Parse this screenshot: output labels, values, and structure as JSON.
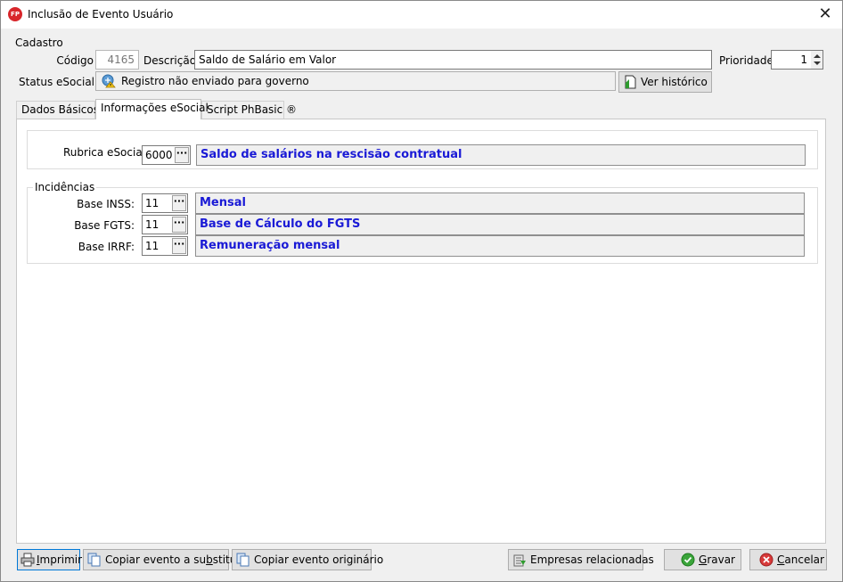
{
  "window": {
    "title": "Inclusão de Evento Usuário",
    "app_icon_text": "FP"
  },
  "cadastro": {
    "group_label": "Cadastro",
    "codigo_label": "Código",
    "codigo_value": "4165",
    "descricao_label": "Descrição",
    "descricao_value": "Saldo de Salário em Valor",
    "prioridade_label": "Prioridade",
    "prioridade_value": "1",
    "status_label": "Status eSocial",
    "status_value": "Registro não enviado para governo",
    "ver_historico_label": "Ver histórico"
  },
  "tabs": [
    {
      "label": "Dados Básicos"
    },
    {
      "label": "Informações eSocial"
    },
    {
      "label": "Script PhBasic ®"
    }
  ],
  "esocial": {
    "rubrica_label": "Rubrica eSocial",
    "rubrica_code": "6000",
    "rubrica_desc": "Saldo de salários na rescisão contratual",
    "incidencias_label": "Incidências",
    "inss_label": "Base INSS:",
    "inss_code": "11",
    "inss_desc": "Mensal",
    "fgts_label": "Base FGTS:",
    "fgts_code": "11",
    "fgts_desc": "Base de Cálculo do FGTS",
    "irrf_label": "Base IRRF:",
    "irrf_code": "11",
    "irrf_desc": "Remuneração mensal",
    "dots": "···"
  },
  "footer": {
    "imprimir_pre": "",
    "imprimir_u": "I",
    "imprimir_post": "mprimir",
    "copiar_sub_pre": "Copiar evento a su",
    "copiar_sub_u": "b",
    "copiar_sub_post": "stituir",
    "copiar_orig": "Copiar evento originário",
    "empresas": "Empresas relacionadas",
    "gravar_u": "G",
    "gravar_post": "ravar",
    "cancelar_u": "C",
    "cancelar_post": "ancelar"
  },
  "colors": {
    "accent_blue": "#1a1ad6",
    "app_icon_red": "#d8262b",
    "ok_green": "#3aa43a",
    "cancel_red": "#d83a3a"
  }
}
